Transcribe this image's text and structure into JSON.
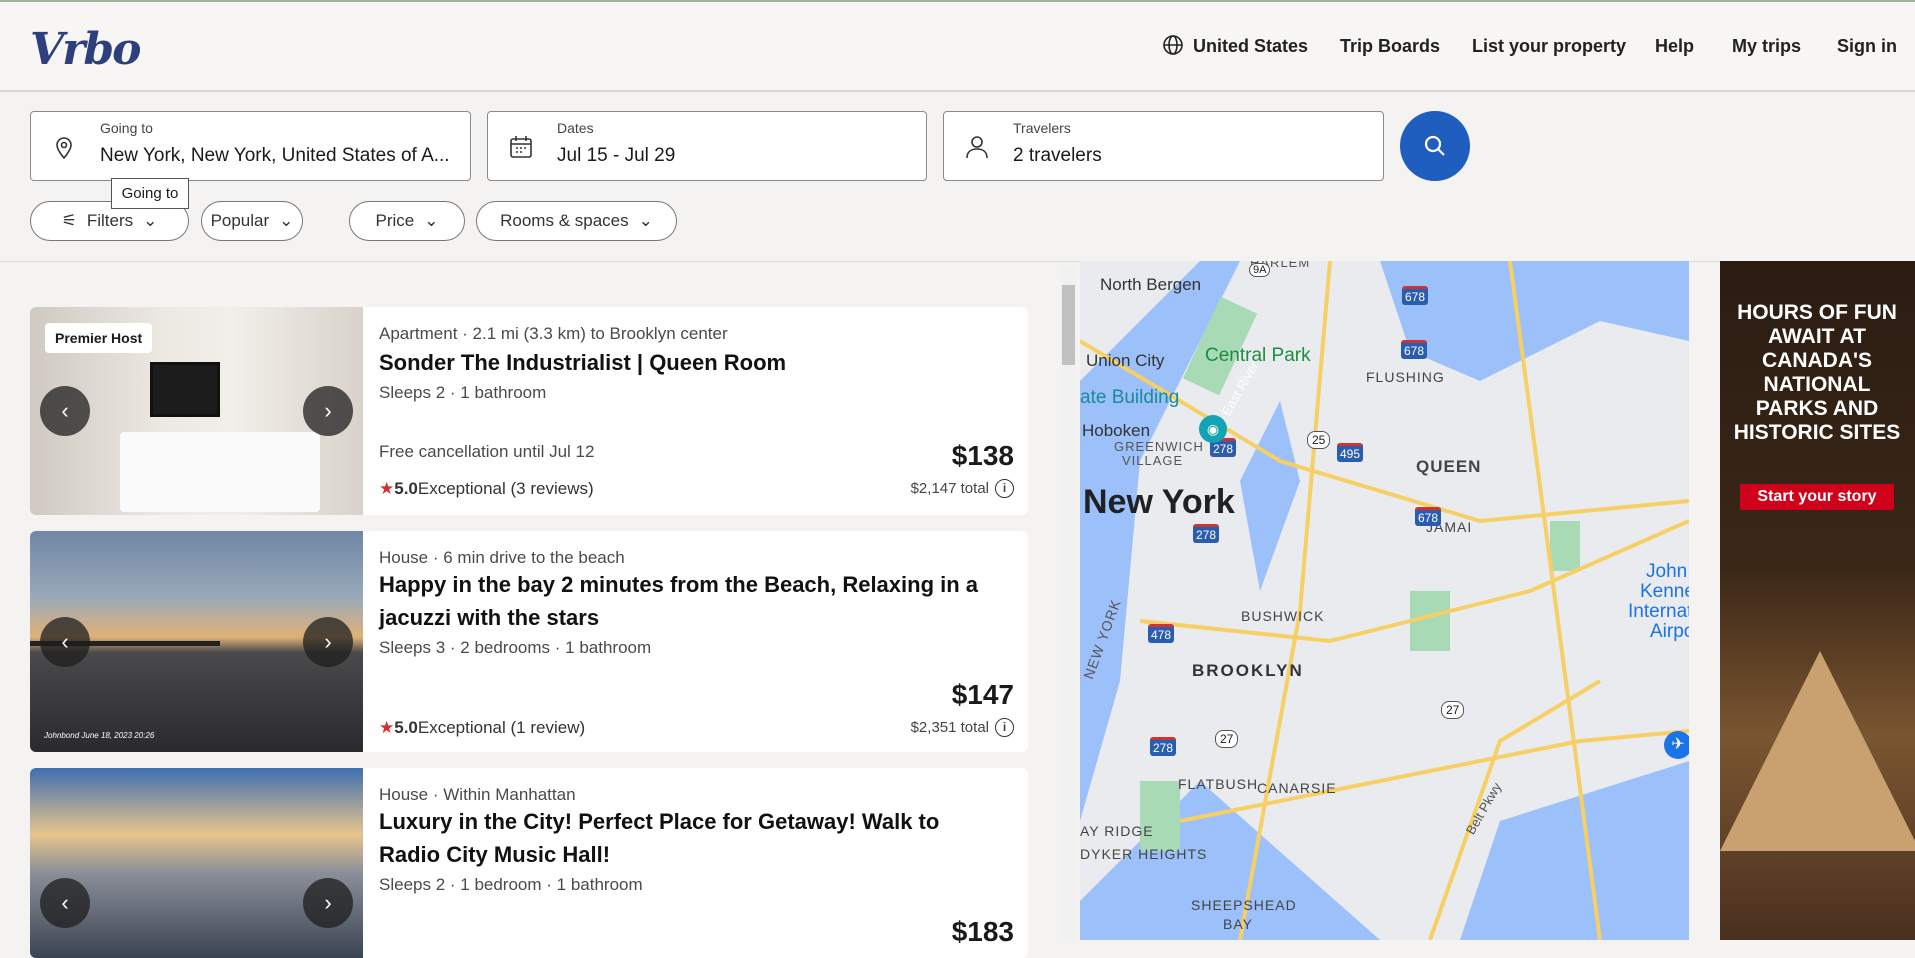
{
  "header": {
    "logo": "Vrbo",
    "nav": [
      {
        "label": "United States",
        "icon": "globe-icon"
      },
      {
        "label": "Trip Boards"
      },
      {
        "label": "List your property"
      },
      {
        "label": "Help"
      },
      {
        "label": "My trips"
      },
      {
        "label": "Sign in"
      }
    ]
  },
  "search": {
    "destination": {
      "label": "Going to",
      "value": "New York, New York, United States of A..."
    },
    "dates": {
      "label": "Dates",
      "value": "Jul 15 - Jul 29"
    },
    "travelers": {
      "label": "Travelers",
      "value": "2 travelers"
    },
    "tooltip": "Going to"
  },
  "filters": [
    {
      "label": "Filters"
    },
    {
      "label": "Popular"
    },
    {
      "label": "Price"
    },
    {
      "label": "Rooms & spaces"
    }
  ],
  "listings": [
    {
      "badge": "Premier Host",
      "meta": "Apartment · 2.1 mi (3.3 km) to Brooklyn center",
      "title": "Sonder The Industrialist | Queen Room",
      "details": "Sleeps 2 · 1 bathroom",
      "cancellation": "Free cancellation until Jul 12",
      "rating": "5.0",
      "rating_text": "Exceptional (3 reviews)",
      "price": "$138",
      "total": "$2,147 total"
    },
    {
      "meta": "House · 6 min drive to the beach",
      "title": "Happy in the bay 2 minutes from the Beach, Relaxing in a jacuzzi with the stars",
      "details": "Sleeps 3 · 2 bedrooms · 1 bathroom",
      "rating": "5.0",
      "rating_text": "Exceptional (1 review)",
      "price": "$147",
      "total": "$2,351 total",
      "photo_caption": "Johnbond June 18, 2023 20:26"
    },
    {
      "meta": "House · Within Manhattan",
      "title": "Luxury in the City! Perfect Place for Getaway! Walk to Radio City Music Hall!",
      "details": "Sleeps 2 · 1 bedroom · 1 bathroom",
      "price": "$183"
    }
  ],
  "map": {
    "labels": [
      "North Bergen",
      "Union City",
      "Central Park",
      "Hoboken",
      "ate Building",
      "GREENWICH",
      "VILLAGE",
      "New York",
      "BUSHWICK",
      "BROOKLYN",
      "FLATBUSH",
      "CANARSIE",
      "FLUSHING",
      "QUEEN",
      "JAMAI",
      "AY RIDGE",
      "DYKER HEIGHTS",
      "SHEEPSHEAD",
      "BAY",
      "HARLEM",
      "East River",
      "NEW YORK",
      "John",
      "Kenne",
      "Internat",
      "Airpo",
      "Belt Pkwy"
    ],
    "shields": [
      "278",
      "278",
      "278",
      "478",
      "495",
      "678",
      "678",
      "678",
      "25",
      "27",
      "27",
      "9A"
    ]
  },
  "ad": {
    "headline": "HOURS OF FUN AWAIT AT CANADA'S NATIONAL PARKS AND HISTORIC SITES",
    "cta": "Start your story"
  },
  "colors": {
    "brand": "#1f5dbf",
    "star": "#d32f2f",
    "ad_cta": "#d0021b"
  }
}
